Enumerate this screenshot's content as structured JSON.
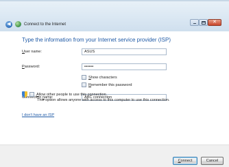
{
  "window": {
    "title": "Connect to the Internet",
    "controls": {
      "close_glyph": "✕"
    },
    "back_glyph": "◀"
  },
  "main": {
    "heading": "Type the information from your Internet service provider (ISP)",
    "user_name": {
      "label_u": "U",
      "label_rest": "ser name:",
      "value": "ASUS"
    },
    "password": {
      "label_u": "P",
      "label_rest": "assword:",
      "value": "••••••"
    },
    "show_characters": {
      "label_u": "S",
      "label_rest": "how characters",
      "checked": false
    },
    "remember_password": {
      "label_u": "R",
      "label_rest": "emember this password",
      "checked": false
    },
    "connection_name": {
      "label_pre": "Connection ",
      "label_u": "n",
      "label_rest": "ame:",
      "value": "ABC connection"
    },
    "allow_others": {
      "label_u": "A",
      "label_rest": "llow other people to use this connection",
      "description": "This option allows anyone with access to this computer to use this connection.",
      "checked": false
    },
    "isp_link": "I don't have an ISP"
  },
  "footer": {
    "connect_u": "C",
    "connect_rest": "onnect",
    "cancel_label": "Cancel"
  },
  "icons": {
    "back": "back-arrow-icon",
    "network": "network-globe-icon",
    "shield": "uac-shield-icon"
  }
}
